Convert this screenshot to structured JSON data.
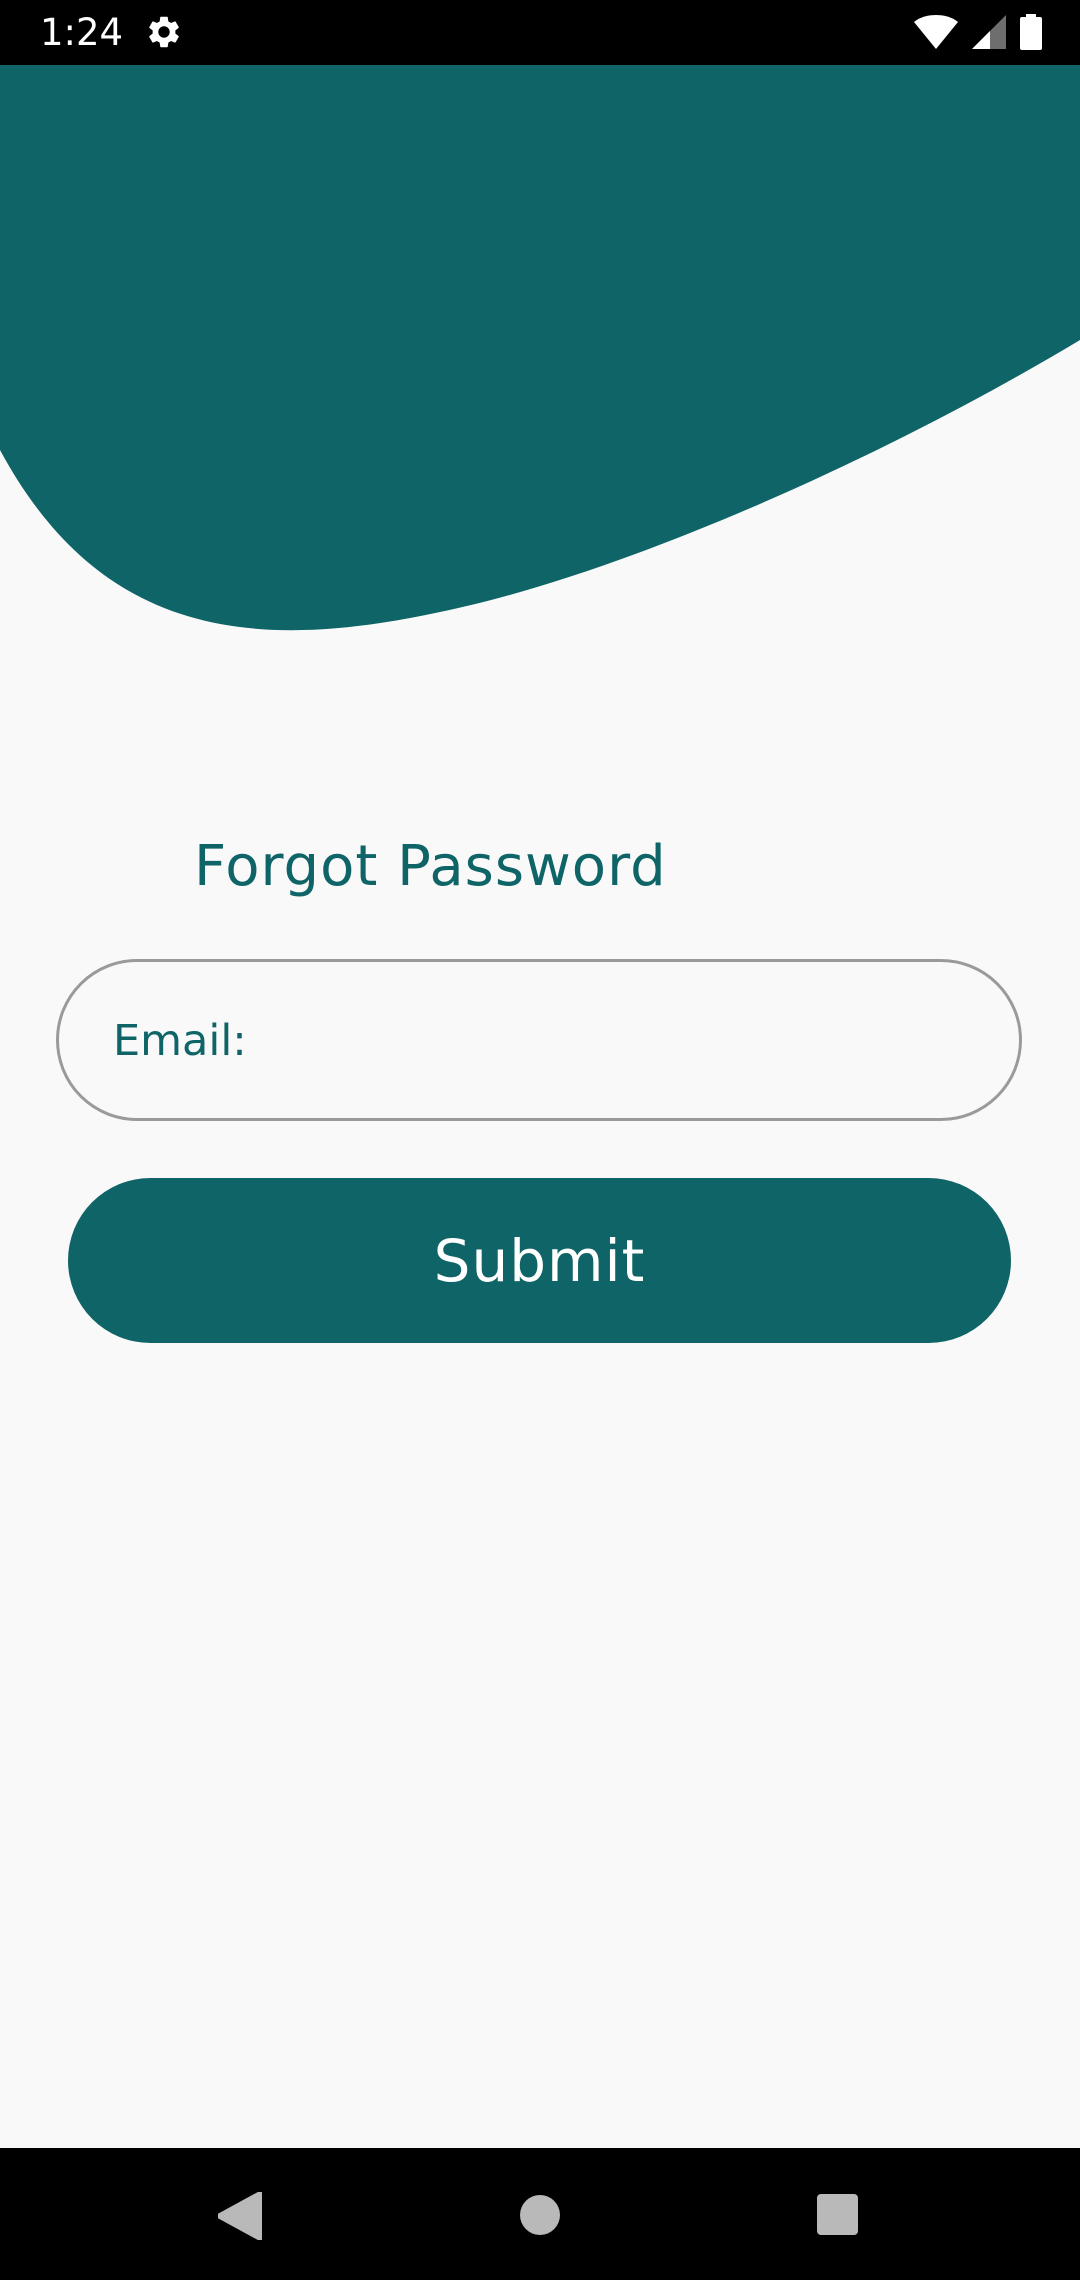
{
  "status_bar": {
    "time": "1:24",
    "icons": [
      "gear-icon",
      "wifi-icon",
      "cellular-signal-icon",
      "battery-icon"
    ]
  },
  "colors": {
    "accent": "#0e6466",
    "background": "#f9f9f9",
    "field_border": "#9a9a9a"
  },
  "form": {
    "title": "Forgot Password",
    "email_label": "Email:",
    "email_value": "",
    "submit_label": "Submit"
  },
  "nav_bar": {
    "icons": [
      "back-icon",
      "home-icon",
      "recents-icon"
    ]
  }
}
